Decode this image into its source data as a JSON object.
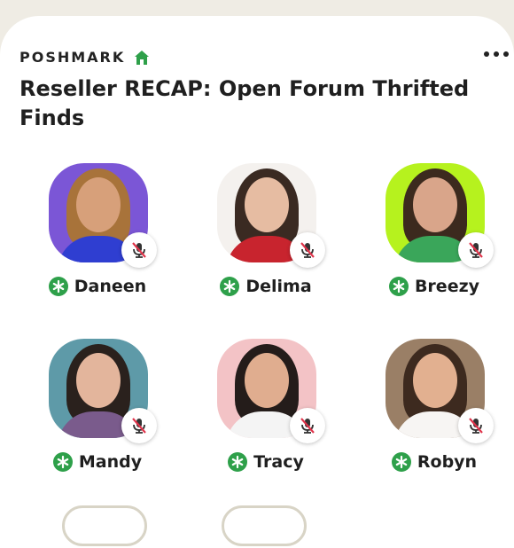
{
  "club": {
    "name": "POSHMARK",
    "icon": "house-icon",
    "accent": "#2ea04a"
  },
  "room": {
    "title": "Reseller RECAP: Open Forum Thrifted Finds"
  },
  "speakers": [
    {
      "name": "Daneen",
      "bg": "#7b56d6",
      "hair": "#a8733a",
      "skin": "#d7a07a",
      "body": "#2f3ed1",
      "muted": true,
      "moderator": true
    },
    {
      "name": "Delima",
      "bg": "#f4f1ee",
      "hair": "#3a2a22",
      "skin": "#e6bca2",
      "body": "#c8242e",
      "muted": true,
      "moderator": true
    },
    {
      "name": "Breezy",
      "bg": "#b6f21e",
      "hair": "#3c2a1e",
      "skin": "#d9a58a",
      "body": "#3aa65a",
      "muted": true,
      "moderator": true
    },
    {
      "name": "Mandy",
      "bg": "#5e9aa8",
      "hair": "#2a211d",
      "skin": "#e3b59c",
      "body": "#7a5b8c",
      "muted": true,
      "moderator": true
    },
    {
      "name": "Tracy",
      "bg": "#f3c3c6",
      "hair": "#241c1a",
      "skin": "#e0ad8f",
      "body": "#f4f4f4",
      "muted": true,
      "moderator": true
    },
    {
      "name": "Robyn",
      "bg": "#9a7f66",
      "hair": "#3d2a1f",
      "skin": "#e2b090",
      "body": "#f7f5f3",
      "muted": true,
      "moderator": true
    }
  ]
}
